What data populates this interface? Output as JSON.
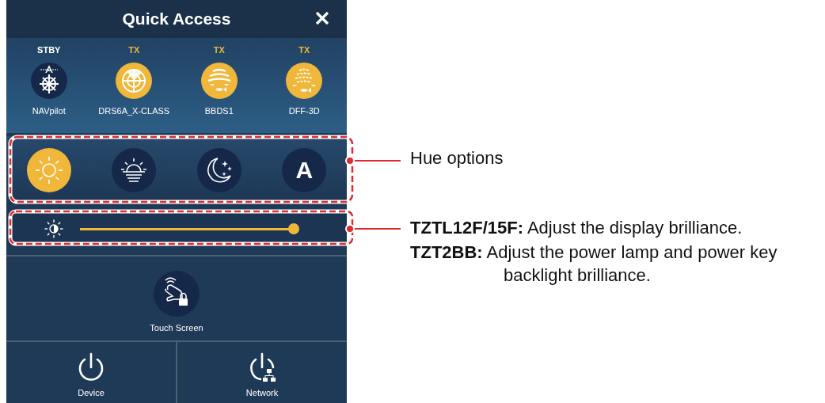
{
  "panel": {
    "title": "Quick Access"
  },
  "devices": [
    {
      "kind": "autopilot",
      "status": "STBY",
      "transmitting": false,
      "name": "NAVpilot"
    },
    {
      "kind": "radar",
      "status": "TX",
      "transmitting": true,
      "name": "DRS6A_X-CLASS"
    },
    {
      "kind": "fishfinder",
      "status": "TX",
      "transmitting": true,
      "name": "BBDS1"
    },
    {
      "kind": "fishfinder3d",
      "status": "TX",
      "transmitting": true,
      "name": "DFF-3D"
    }
  ],
  "hue_options": [
    {
      "kind": "day",
      "selected": true
    },
    {
      "kind": "dusk",
      "selected": false
    },
    {
      "kind": "night",
      "selected": false
    },
    {
      "kind": "auto",
      "label": "A",
      "selected": false
    }
  ],
  "brilliance": {
    "level": 1
  },
  "touch_screen": {
    "kind": "touch-lock",
    "label": "Touch Screen"
  },
  "bottom_buttons": [
    {
      "kind": "power",
      "label": "Device"
    },
    {
      "kind": "network",
      "label": "Network"
    }
  ],
  "callouts": [
    {
      "text": "Hue options"
    },
    {
      "paragraphs": [
        "**TZTL12F/15F:** Adjust the display brilliance.",
        "**TZT2BB:** Adjust the power lamp and power key backlight brilliance."
      ]
    }
  ]
}
